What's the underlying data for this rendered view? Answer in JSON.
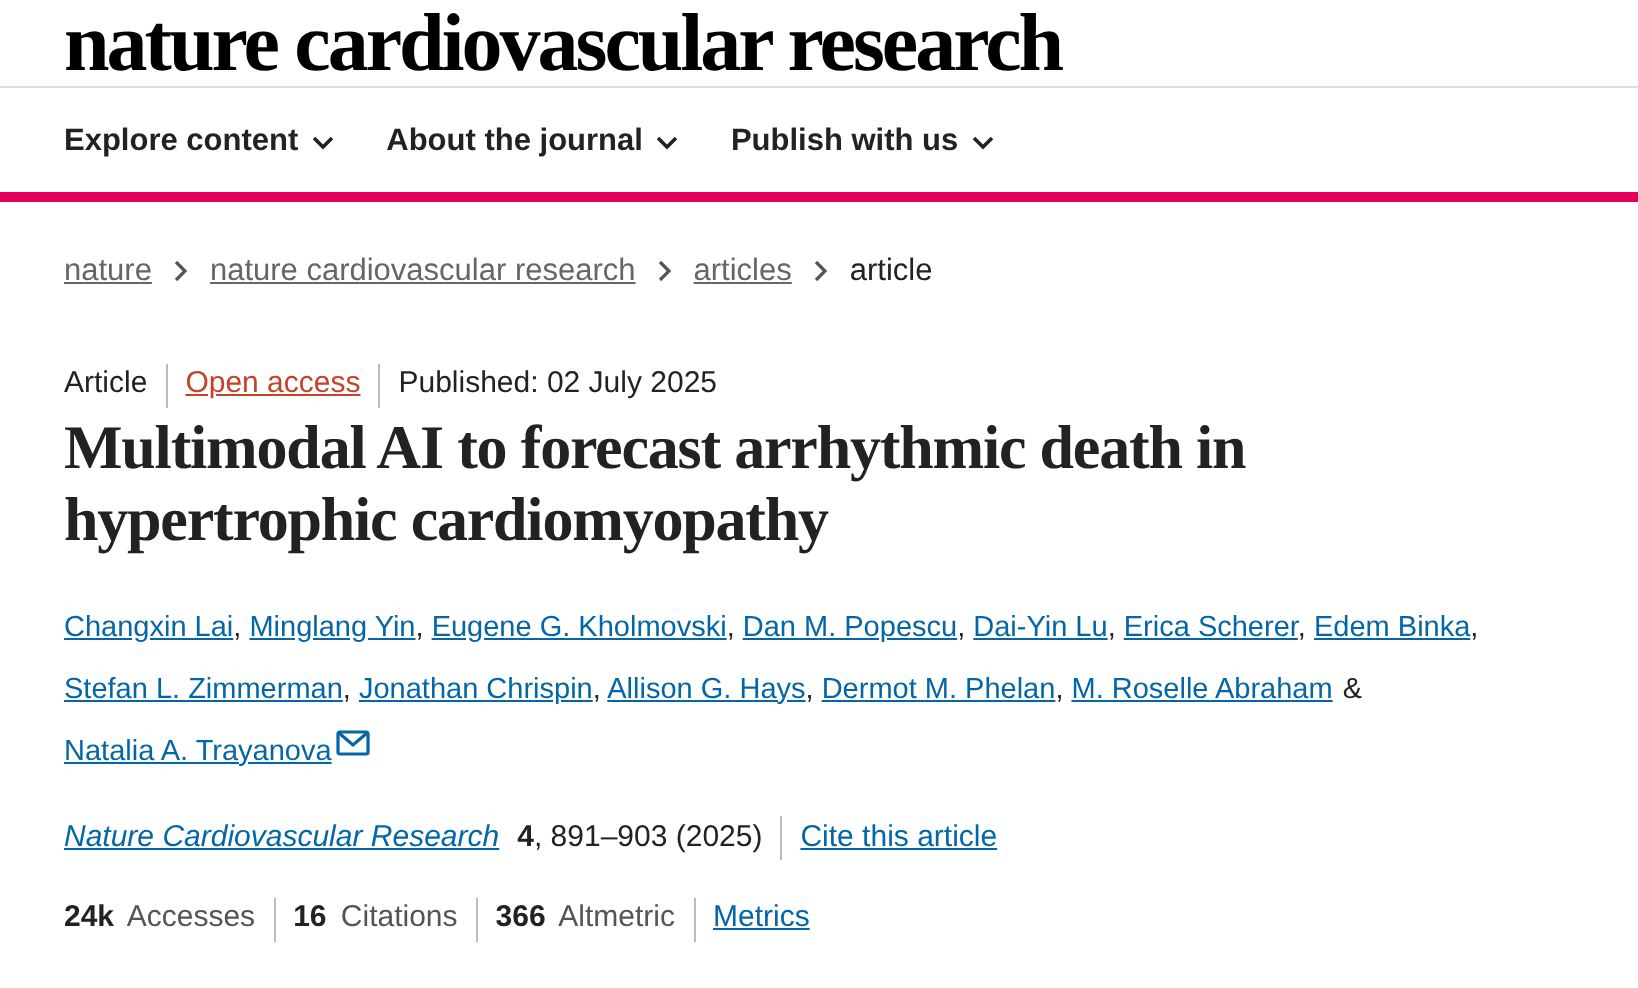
{
  "journal_title": "nature cardiovascular research",
  "nav": [
    {
      "label": "Explore content"
    },
    {
      "label": "About the journal"
    },
    {
      "label": "Publish with us"
    }
  ],
  "breadcrumbs": [
    {
      "label": "nature",
      "kind": "link"
    },
    {
      "label": "nature cardiovascular research",
      "kind": "link"
    },
    {
      "label": "articles",
      "kind": "link"
    },
    {
      "label": "article",
      "kind": "current"
    }
  ],
  "meta": {
    "type": "Article",
    "access": "Open access",
    "published": "Published: 02 July 2025"
  },
  "title": "Multimodal AI to forecast arrhythmic death in hypertrophic cardiomyopathy",
  "authors": [
    {
      "name": "Changxin Lai",
      "separator": ",",
      "contact": false
    },
    {
      "name": "Minglang Yin",
      "separator": ",",
      "contact": false
    },
    {
      "name": "Eugene G. Kholmovski",
      "separator": ",",
      "contact": false
    },
    {
      "name": "Dan M. Popescu",
      "separator": ",",
      "contact": false
    },
    {
      "name": "Dai-Yin Lu",
      "separator": ",",
      "contact": false
    },
    {
      "name": "Erica Scherer",
      "separator": ",",
      "contact": false
    },
    {
      "name": "Edem Binka",
      "separator": ",",
      "contact": false
    },
    {
      "name": "Stefan L. Zimmerman",
      "separator": ",",
      "contact": false
    },
    {
      "name": "Jonathan Chrispin",
      "separator": ",",
      "contact": false
    },
    {
      "name": "Allison G. Hays",
      "separator": ",",
      "contact": false
    },
    {
      "name": "Dermot M. Phelan",
      "separator": ",",
      "contact": false
    },
    {
      "name": "M. Roselle Abraham",
      "separator": "&",
      "contact": false
    },
    {
      "name": "Natalia A. Trayanova",
      "contact": true
    }
  ],
  "citation": {
    "journal": "Nature Cardiovascular Research",
    "volume": "4",
    "pages": ", 891–903 (2025)",
    "cite_link": "Cite this article"
  },
  "metrics": [
    "**24k** Accesses",
    "**16** Citations",
    "**366** Altmetric"
  ],
  "metrics_link": "Metrics"
}
